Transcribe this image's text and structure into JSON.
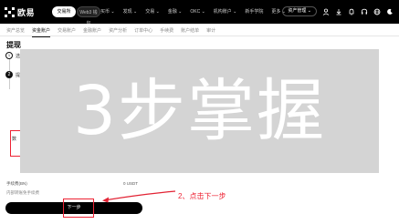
{
  "topnav": {
    "logo_text": "欧易",
    "tabs": [
      "交易所",
      "Web3 钱包"
    ],
    "items": [
      "买币 ⌄",
      "发现 ⌄",
      "交易 ⌄",
      "金融 ⌄",
      "OKC ⌄",
      "机构账户 ⌄",
      "新手学院",
      "更多 ⌄"
    ],
    "assets_label": "资产管理 ⌄"
  },
  "subnav": {
    "items": [
      "资产总览",
      "资金账户",
      "交易账户",
      "金融账户",
      "资产分析",
      "订单中心",
      "手续费",
      "账户结单",
      "审计"
    ],
    "active_index": 1
  },
  "page": {
    "title": "提现",
    "step1_text": "选",
    "step2_text": "提",
    "step1_num": "1",
    "step2_num": "2",
    "amount_label": "数",
    "fee_left": "手续费(BN)",
    "fee_right": "0 USDT",
    "min_text": "内部转账免手续费",
    "next_label": "下一步"
  },
  "annotation": {
    "text": "2、点击下一步",
    "color": "#e22233"
  },
  "overlay": {
    "text": "3步掌握"
  }
}
